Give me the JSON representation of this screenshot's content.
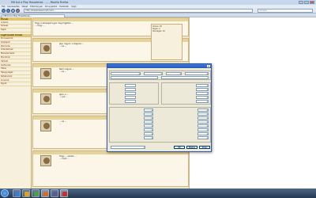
{
  "browser": {
    "window_title": "Mit tud a Play Hosszlecse - ... - Mozilla Firefox",
    "menu": [
      "Fájl",
      "Szerkesztés",
      "Nézet",
      "Előzmények",
      "Könyvjelzők",
      "Eszközök",
      "Súgó"
    ],
    "url": "http://www.hwsw.hu/forum/...",
    "search_placeholder": "Google",
    "tab_label": "Mit tud a Play Hosszlecse..."
  },
  "sidebar": {
    "section1": "Fórum",
    "items1": [
      "Új téma",
      "Keresés",
      "Tagok"
    ],
    "section2": "Legfrissebb témák",
    "items2": [
      "Processzorok",
      "Alaplapok",
      "Memóriák",
      "Videókártyák",
      "Merevlemezek",
      "Monitorok",
      "Hálózat",
      "Szoftverek",
      "Hűtés",
      "Tápegységek",
      "Notebookok",
      "Konzolok",
      "Egyéb"
    ]
  },
  "posts": [
    {
      "author": "",
      "lines": [
        "Hogy a szöveget úgyis meg fogjátok ...",
        "... hogy ..."
      ]
    },
    {
      "author": "",
      "lines": [
        "Jaja. Ingyen, a Sagana ...",
        "... és ..."
      ]
    },
    {
      "author": "",
      "lines": [
        "Nem nagyon ...",
        "... és ..."
      ]
    },
    {
      "author": "",
      "lines": [
        "Igen, a ...",
        "... sok ..."
      ]
    },
    {
      "author": "",
      "lines": [
        "... és ...",
        "..."
      ]
    },
    {
      "author": "",
      "lines": [
        "Hogy ... sokkal ...",
        "... most ..."
      ]
    }
  ],
  "stats": {
    "lines": [
      "Online: 18",
      "Tagok: 2",
      "Vendégek: 16"
    ]
  },
  "dialog": {
    "title": "",
    "fields": [],
    "buttons": [
      "OK",
      "Mégse",
      "Kilép"
    ]
  },
  "taskbar": {
    "time": "",
    "date": ""
  }
}
